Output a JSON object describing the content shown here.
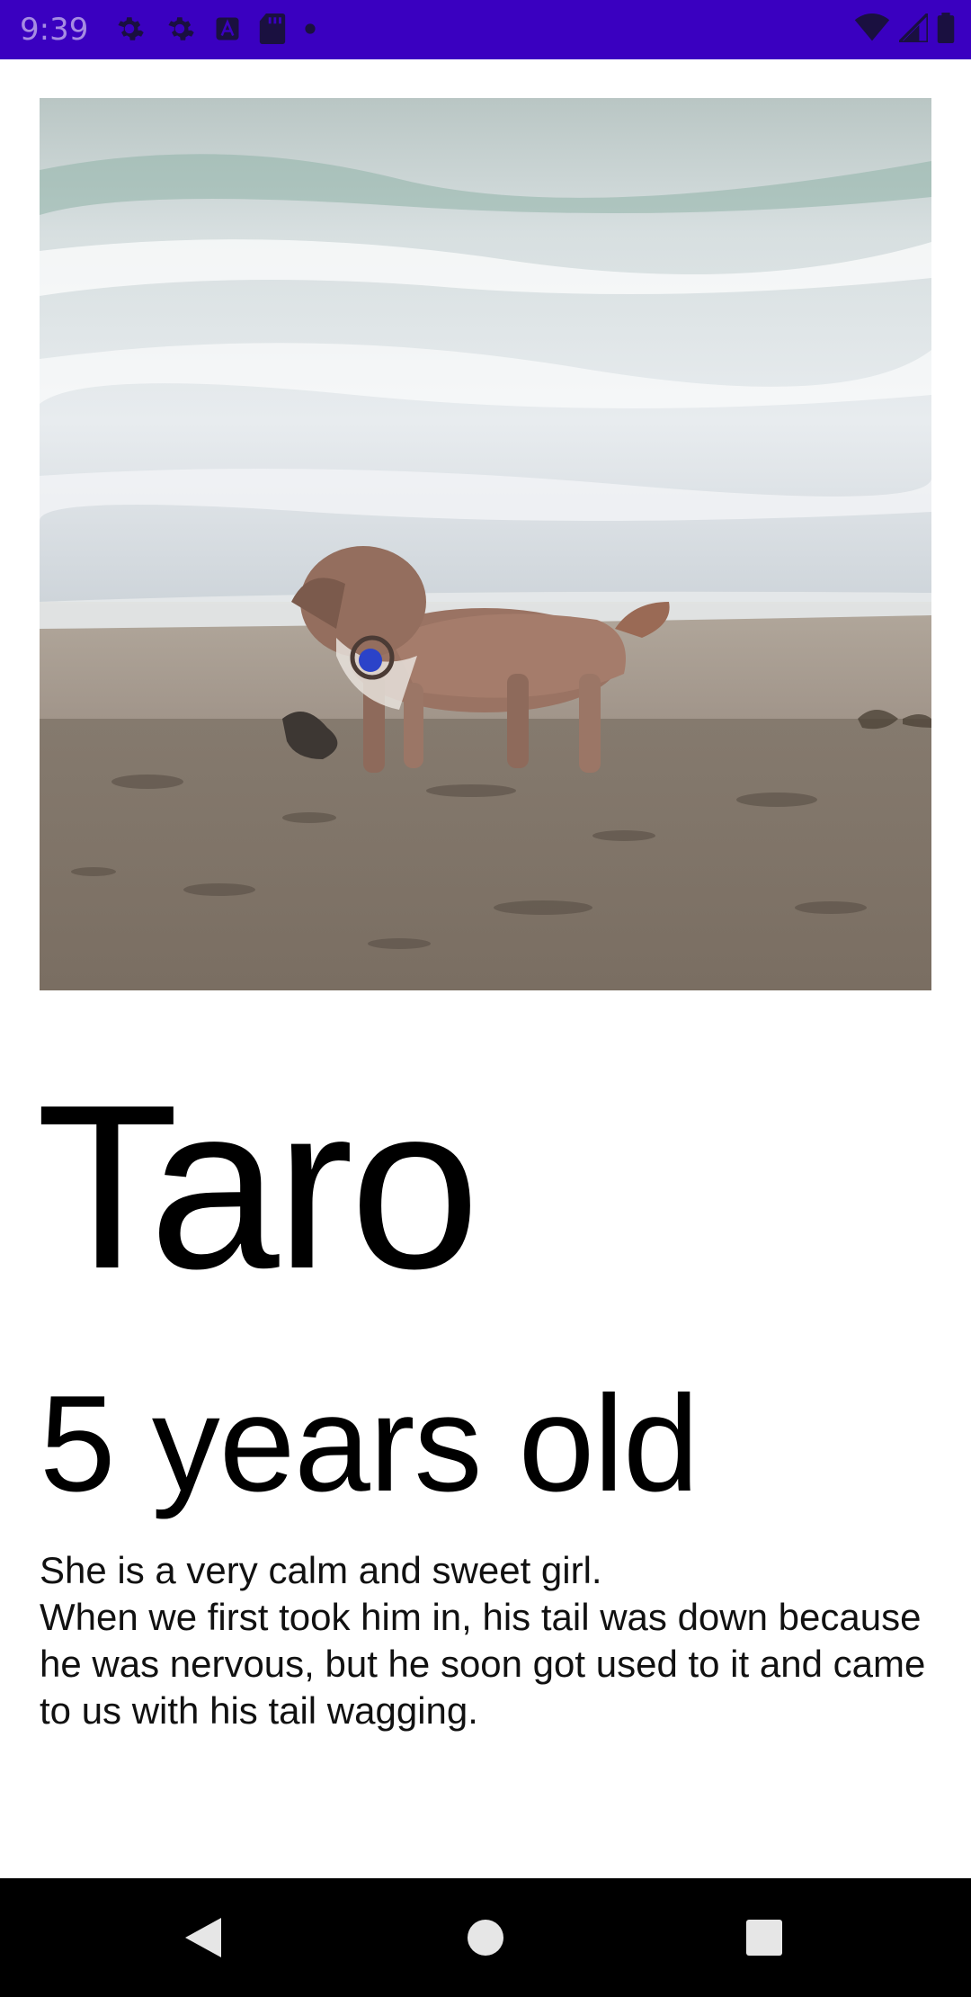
{
  "status_bar": {
    "time": "9:39",
    "background_color": "#3a00c0",
    "left_icons": [
      "gear-icon",
      "gear-icon",
      "text-a-icon",
      "sd-card-icon",
      "dot-icon"
    ],
    "right_icons": [
      "wifi-icon",
      "signal-icon",
      "battery-icon"
    ]
  },
  "photo": {
    "subject": "dog-on-beach-photo"
  },
  "pet": {
    "name": "Taro",
    "age": "5 years old",
    "description_lines": [
      "She is a very calm and sweet girl.",
      "When we first took him in, his tail was down because he was nervous, but he soon got used to it and came to us with his tail wagging."
    ]
  },
  "nav_bar": {
    "buttons": [
      "back-icon",
      "home-icon",
      "recents-icon"
    ]
  }
}
